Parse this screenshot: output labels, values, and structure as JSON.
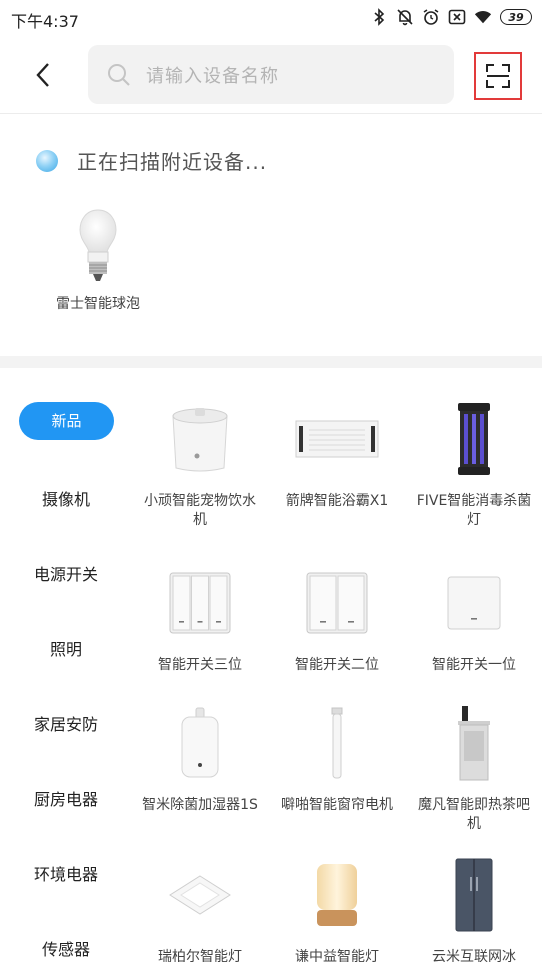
{
  "status": {
    "time": "下午4:37",
    "battery": "39"
  },
  "search": {
    "placeholder": "请输入设备名称"
  },
  "nearby": {
    "scanning_text": "正在扫描附近设备...",
    "devices": [
      {
        "name": "雷士智能球泡"
      }
    ]
  },
  "categories": [
    {
      "label": "新品",
      "active": true
    },
    {
      "label": "摄像机"
    },
    {
      "label": "电源开关"
    },
    {
      "label": "照明"
    },
    {
      "label": "家居安防"
    },
    {
      "label": "厨房电器"
    },
    {
      "label": "环境电器"
    },
    {
      "label": "传感器"
    }
  ],
  "products": [
    {
      "name": "小顽智能宠物饮水机",
      "icon": "pet-fountain"
    },
    {
      "name": "箭牌智能浴霸X1",
      "icon": "bath-heater"
    },
    {
      "name": "FIVE智能消毒杀菌灯",
      "icon": "uv-lamp"
    },
    {
      "name": "智能开关三位",
      "icon": "switch-3"
    },
    {
      "name": "智能开关二位",
      "icon": "switch-2"
    },
    {
      "name": "智能开关一位",
      "icon": "switch-1"
    },
    {
      "name": "智米除菌加湿器1S",
      "icon": "humidifier"
    },
    {
      "name": "噼啪智能窗帘电机",
      "icon": "curtain-motor"
    },
    {
      "name": "魔凡智能即热茶吧机",
      "icon": "tea-bar"
    },
    {
      "name": "瑞柏尔智能灯",
      "icon": "ceiling-light"
    },
    {
      "name": "谦中益智能灯",
      "icon": "table-lamp"
    },
    {
      "name": "云米互联网冰",
      "icon": "fridge"
    }
  ],
  "colors": {
    "accent": "#2196f3",
    "scan_highlight": "#e23a3a"
  }
}
